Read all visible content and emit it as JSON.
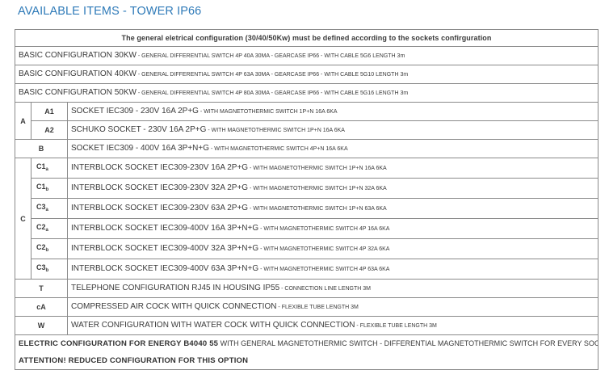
{
  "title": "AVAILABLE ITEMS - TOWER IP66",
  "header": "The general eletrical configuration (30/40/50Kw) must be defined according to the sockets confirguration",
  "basic": [
    {
      "main": "BASIC CONFIGURATION 30KW",
      "detail": " - GENERAL  DIFFERENTIAL SWITCH 4P 40A 30MA - GEARCASE IP66 - WITH CABLE 5G6 LENGTH 3m"
    },
    {
      "main": "BASIC CONFIGURATION 40KW",
      "detail": " - GENERAL  DIFFERENTIAL SWITCH 4P 63A 30MA - GEARCASE IP66 - WITH CABLE 5G10 LENGTH 3m"
    },
    {
      "main": "BASIC CONFIGURATION 50KW",
      "detail": " - GENERAL  DIFFERENTIAL SWITCH 4P 80A 30MA - GEARCASE IP66 - WITH CABLE 5G16 LENGTH 3m"
    }
  ],
  "group_a": {
    "label": "A",
    "rows": [
      {
        "code": "A1",
        "main": "SOCKET IEC309 - 230V 16A 2P+G",
        "detail": " - WITH MAGNETOTHERMIC SWITCH 1P+N 16A 6KA"
      },
      {
        "code": "A2",
        "main": " SCHUKO SOCKET - 230V 16A 2P+G",
        "detail": " - WITH MAGNETOTHERMIC SWITCH 1P+N 16A 6KA"
      }
    ]
  },
  "group_b": {
    "code": "B",
    "main": "SOCKET IEC309 - 400V 16A 3P+N+G",
    "detail": " - WITH MAGNETOTHERMIC SWITCH 4P+N 16A 6KA"
  },
  "group_c": {
    "label": "C",
    "rows": [
      {
        "code": "C1",
        "sub": "a",
        "main": "INTERBLOCK SOCKET IEC309-230V 16A 2P+G",
        "detail": " - WITH MAGNETOTHERMIC SWITCH 1P+N 16A 6KA"
      },
      {
        "code": "C1",
        "sub": "b",
        "main": "INTERBLOCK SOCKET IEC309-230V 32A 2P+G",
        "detail": " - WITH MAGNETOTHERMIC SWITCH 1P+N 32A 6KA"
      },
      {
        "code": "C3",
        "sub": "a",
        "main": "INTERBLOCK SOCKET IEC309-230V 63A 2P+G",
        "detail": " - WITH MAGNETOTHERMIC SWITCH 1P+N 63A 6KA"
      },
      {
        "code": "C2",
        "sub": "a",
        "main": "INTERBLOCK SOCKET IEC309-400V 16A 3P+N+G",
        "detail": " - WITH MAGNETOTHERMIC SWITCH 4P 16A 6KA"
      },
      {
        "code": "C2",
        "sub": "b",
        "main": "INTERBLOCK SOCKET IEC309-400V 32A 3P+N+G",
        "detail": " - WITH MAGNETOTHERMIC SWITCH 4P 32A 6KA"
      },
      {
        "code": "C3",
        "sub": "b",
        "main": "INTERBLOCK SOCKET IEC309-400V 63A 3P+N+G",
        "detail": " - WITH MAGNETOTHERMIC SWITCH 4P 63A 6KA"
      }
    ]
  },
  "extras": [
    {
      "code": "T",
      "main": "TELEPHONE CONFIGURATION RJ45 IN HOUSING IP55",
      "detail": " - CONNECTION LINE LENGTH 3M"
    },
    {
      "code": "cA",
      "main": "COMPRESSED AIR COCK WITH QUICK CONNECTION",
      "detail": " - FLEXIBLE TUBE LENGTH 3M"
    },
    {
      "code": "W",
      "main": "WATER CONFIGURATION WITH WATER COCK WITH QUICK CONNECTION",
      "detail": " - FLEXIBLE TUBE LENGTH 3M"
    }
  ],
  "footer": {
    "bold": "ELECTRIC CONFIGURATION FOR ENERGY B4040 55",
    "detail": " WITH GENERAL MAGNETOTHERMIC SWITCH - DIFFERENTIAL MAGNETOTHERMIC SWITCH FOR EVERY SOCKET",
    "attention": "ATTENTION! REDUCED CONFIGURATION FOR THIS OPTION"
  },
  "colors": {
    "title": "#2e7ab8",
    "border": "#8a8a8a",
    "text": "#3a3a3a"
  }
}
